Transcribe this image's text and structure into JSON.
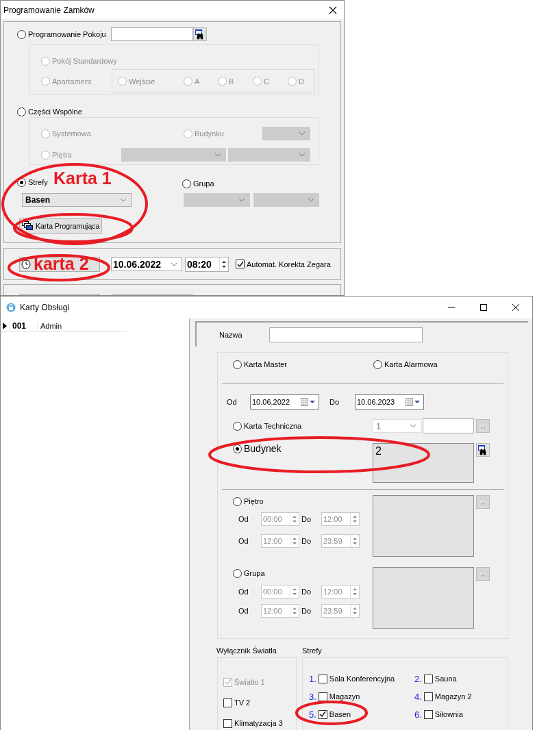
{
  "back_window": {
    "title": "Programowanie Zamków",
    "room_programming": {
      "label": "Programowanie Pokoju",
      "selected": false
    },
    "room_types": [
      {
        "label": "Pokój Standardowy",
        "selected": false,
        "disabled": true
      },
      {
        "label": "Apartament",
        "selected": false,
        "disabled": true
      }
    ],
    "entrances": [
      {
        "label": "Wejście",
        "selected": false,
        "disabled": true
      },
      {
        "label": "A",
        "selected": false,
        "disabled": true
      },
      {
        "label": "B",
        "selected": false,
        "disabled": true
      },
      {
        "label": "C",
        "selected": false,
        "disabled": true
      },
      {
        "label": "D",
        "selected": false,
        "disabled": true
      }
    ],
    "common_areas": {
      "label": "Części Wspólne",
      "selected": false
    },
    "common_options": [
      {
        "label": "Systemowa",
        "selected": false,
        "disabled": true
      },
      {
        "label": "Budynku",
        "selected": false,
        "disabled": true
      },
      {
        "label": "Piętra",
        "selected": false,
        "disabled": true
      }
    ],
    "zones": {
      "label": "Strefy",
      "selected": true,
      "value": "Basen"
    },
    "group": {
      "label": "Grupa",
      "selected": false
    },
    "programming_card_button": "Karta Programująca",
    "clock": {
      "date": "10.06.2022",
      "time": "08:20",
      "auto_correct": {
        "label": "Automat. Korekta Zegara",
        "checked": true
      }
    },
    "annotations": [
      {
        "text": "Karta 1"
      },
      {
        "text": "karta 2"
      }
    ]
  },
  "front_window": {
    "title": "Karty Obsługi",
    "cards": [
      {
        "code": "001",
        "name": "Admin",
        "selected": true
      }
    ],
    "name_label": "Nazwa",
    "card_types": [
      {
        "label": "Karta Master",
        "selected": false
      },
      {
        "label": "Karta Alarmowa",
        "selected": false
      }
    ],
    "validity": {
      "from_label": "Od",
      "from": "10.06.2022",
      "to_label": "Do",
      "to": "10.06.2023"
    },
    "technical": {
      "label": "Karta Techniczna",
      "selected": false,
      "value": "1"
    },
    "building": {
      "label": "Budynek",
      "selected": true,
      "value": "2"
    },
    "sections": [
      {
        "label": "Piętro",
        "selected": false,
        "rows": [
          {
            "from_label": "Od",
            "from": "00:00",
            "to_label": "Do",
            "to": "12:00"
          },
          {
            "from_label": "Od",
            "from": "12:00",
            "to_label": "Do",
            "to": "23:59"
          }
        ]
      },
      {
        "label": "Grupa",
        "selected": false,
        "rows": [
          {
            "from_label": "Od",
            "from": "00:00",
            "to_label": "Do",
            "to": "12:00"
          },
          {
            "from_label": "Od",
            "from": "12:00",
            "to_label": "Do",
            "to": "23:59"
          }
        ]
      }
    ],
    "light_switch": {
      "title": "Wyłącznik Światła",
      "items": [
        {
          "label": "Światło 1",
          "checked": true,
          "disabled": true
        },
        {
          "label": "TV 2",
          "checked": false,
          "disabled": false
        },
        {
          "label": "Klimatyzacja 3",
          "checked": false,
          "disabled": false
        }
      ]
    },
    "zones": {
      "title": "Strefy",
      "items": [
        {
          "number": "1.",
          "label": "Sala Konferencyjna",
          "checked": false
        },
        {
          "number": "2.",
          "label": "Sauna",
          "checked": false
        },
        {
          "number": "3.",
          "label": "Magazyn",
          "checked": false
        },
        {
          "number": "4.",
          "label": "Magazyn 2",
          "checked": false
        },
        {
          "number": "5.",
          "label": "Basen",
          "checked": true
        },
        {
          "number": "6.",
          "label": "Siłownia",
          "checked": false
        }
      ]
    }
  }
}
